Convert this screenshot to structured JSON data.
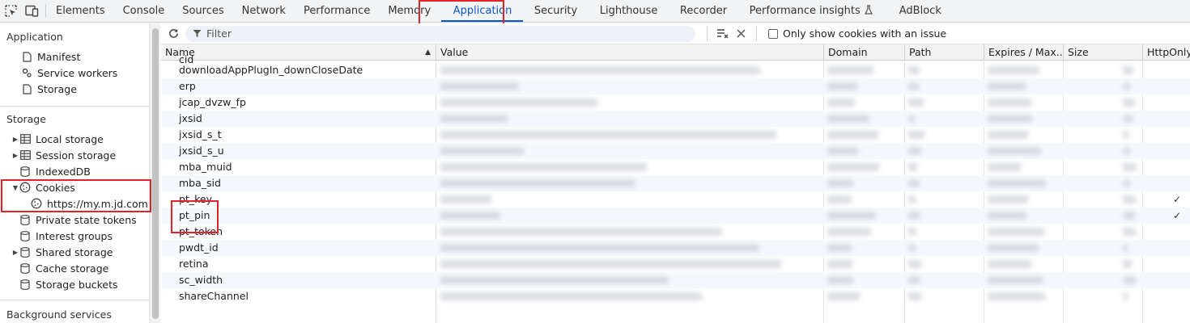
{
  "tabs": [
    {
      "label": "Elements",
      "active": false
    },
    {
      "label": "Console",
      "active": false
    },
    {
      "label": "Sources",
      "active": false
    },
    {
      "label": "Network",
      "active": false
    },
    {
      "label": "Performance",
      "active": false
    },
    {
      "label": "Memory",
      "active": false
    },
    {
      "label": "Application",
      "active": true
    },
    {
      "label": "Security",
      "active": false
    },
    {
      "label": "Lighthouse",
      "active": false
    },
    {
      "label": "Recorder",
      "active": false
    },
    {
      "label": "Performance insights",
      "active": false,
      "icon": "flask-icon"
    },
    {
      "label": "AdBlock",
      "active": false
    }
  ],
  "sidebar": {
    "application_title": "Application",
    "application_items": [
      {
        "label": "Manifest",
        "icon": "file-icon"
      },
      {
        "label": "Service workers",
        "icon": "gears-icon"
      },
      {
        "label": "Storage",
        "icon": "file-icon"
      }
    ],
    "storage_title": "Storage",
    "storage_items": [
      {
        "label": "Local storage",
        "icon": "grid-icon",
        "expandable": true,
        "expanded": false
      },
      {
        "label": "Session storage",
        "icon": "grid-icon",
        "expandable": true,
        "expanded": false
      },
      {
        "label": "IndexedDB",
        "icon": "database-icon",
        "expandable": false
      },
      {
        "label": "Cookies",
        "icon": "cookie-icon",
        "expandable": true,
        "expanded": true
      },
      {
        "label": "https://my.m.jd.com",
        "icon": "cookie-icon",
        "child": true,
        "selected": true
      },
      {
        "label": "Private state tokens",
        "icon": "database-icon",
        "expandable": false
      },
      {
        "label": "Interest groups",
        "icon": "database-icon",
        "expandable": false
      },
      {
        "label": "Shared storage",
        "icon": "database-icon",
        "expandable": true,
        "expanded": false
      },
      {
        "label": "Cache storage",
        "icon": "database-icon",
        "expandable": false
      },
      {
        "label": "Storage buckets",
        "icon": "database-icon",
        "expandable": false
      }
    ],
    "background_title": "Background services"
  },
  "toolbar": {
    "filter_placeholder": "Filter",
    "only_issues_label": "Only show cookies with an issue",
    "only_issues_checked": false
  },
  "table": {
    "columns": [
      "Name",
      "Value",
      "Domain",
      "Path",
      "Expires / Max...",
      "Size",
      "HttpOnly"
    ],
    "sorted_column": "Name",
    "sort_direction": "ascending",
    "partial_top_row": "cid",
    "rows": [
      {
        "name": "downloadAppPlugIn_downCloseDate",
        "http_only": false
      },
      {
        "name": "erp",
        "http_only": false
      },
      {
        "name": "jcap_dvzw_fp",
        "http_only": false
      },
      {
        "name": "jxsid",
        "http_only": false
      },
      {
        "name": "jxsid_s_t",
        "http_only": false
      },
      {
        "name": "jxsid_s_u",
        "http_only": false
      },
      {
        "name": "mba_muid",
        "http_only": false
      },
      {
        "name": "mba_sid",
        "http_only": false
      },
      {
        "name": "pt_key",
        "http_only": true
      },
      {
        "name": "pt_pin",
        "http_only": true
      },
      {
        "name": "pt_token",
        "http_only": false
      },
      {
        "name": "pwdt_id",
        "http_only": false
      },
      {
        "name": "retina",
        "http_only": false
      },
      {
        "name": "sc_width",
        "http_only": false
      },
      {
        "name": "shareChannel",
        "http_only": false
      }
    ],
    "check_glyph": "✓"
  },
  "colors": {
    "accent": "#0b57d0",
    "highlight": "#e0242a"
  }
}
